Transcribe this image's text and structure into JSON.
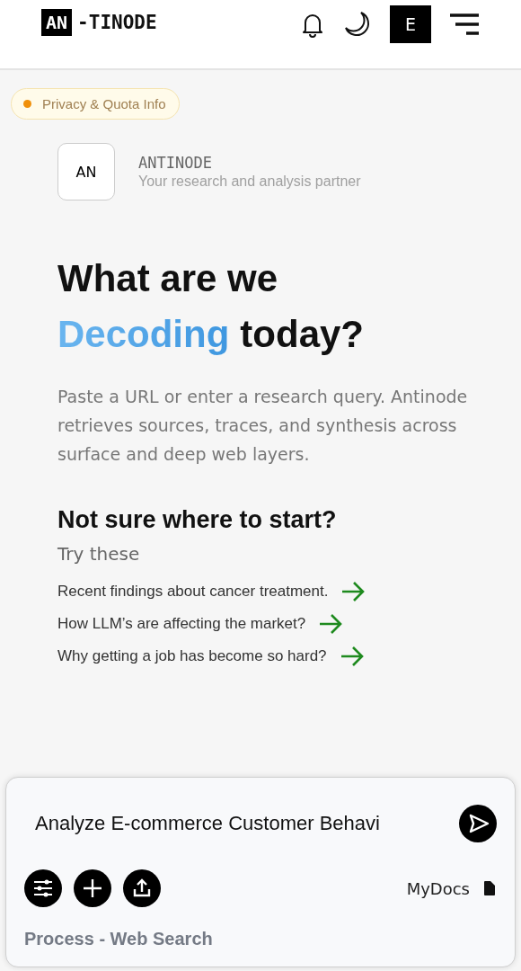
{
  "header": {
    "logo_mark": "AN",
    "logo_text": "-TINODE",
    "avatar_letter": "E"
  },
  "privacy_badge": {
    "label": "Privacy & Quota Info",
    "color": "#f0900a"
  },
  "brand": {
    "mark": "AN",
    "name": "ANTINODE",
    "tagline": "Your research and analysis partner"
  },
  "hero": {
    "line1": "What are we",
    "highlight": "Decoding",
    "rest": "today?",
    "description": "Paste a URL or enter a research query. Antinode retrieves sources, traces, and synthesis across surface and deep web layers."
  },
  "suggestions": {
    "title": "Not sure where to start?",
    "subtitle": "Try these",
    "items": [
      "Recent findings about cancer treatment.",
      "How LLM’s are affecting the market?",
      "Why getting a job has become so hard?"
    ]
  },
  "composer": {
    "value": "Analyze E-commerce Customer Behavi",
    "docs_label": "MyDocs",
    "mode": "Process - Web Search"
  }
}
